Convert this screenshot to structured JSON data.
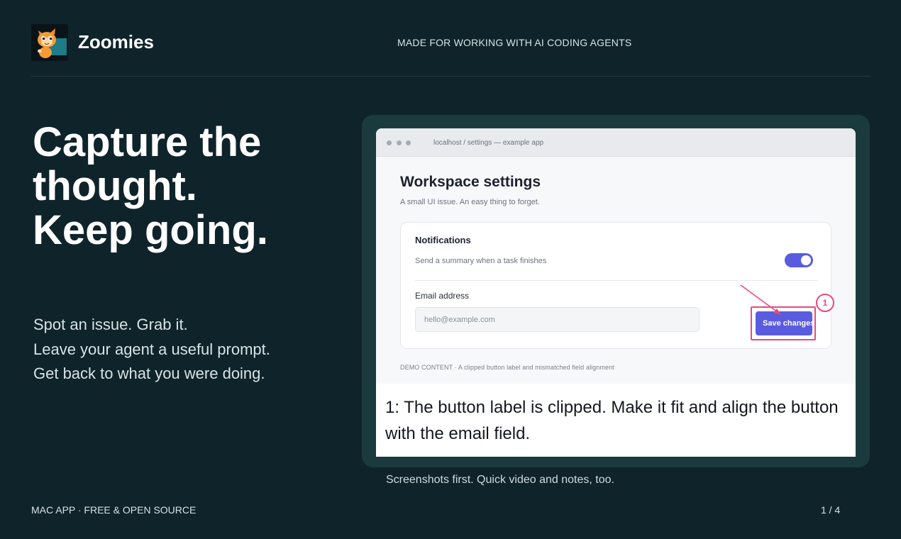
{
  "brand": {
    "name": "Zoomies",
    "logo_icon": "cat-logo-icon"
  },
  "header": {
    "tagline": "MADE FOR WORKING WITH AI CODING AGENTS"
  },
  "hero": {
    "title_lines": [
      "Capture the",
      "thought.",
      "Keep going."
    ],
    "body_lines": [
      "Spot an issue. Grab it.",
      "Leave your agent a useful prompt.",
      "Get back to what you were doing."
    ]
  },
  "showcase": {
    "window": {
      "url": "localhost / settings — example app",
      "title": "Workspace settings",
      "subtitle": "A small UI issue. An easy thing to forget.",
      "notifications": {
        "title": "Notifications",
        "description": "Send a summary when a task finishes",
        "toggle_on": true
      },
      "email": {
        "label": "Email address",
        "placeholder": "hello@example.com",
        "value": ""
      },
      "save_button_label": "Save changes",
      "annotation_number": "1",
      "demo_note": "DEMO CONTENT · A clipped button label and mismatched field alignment"
    },
    "caption": "1: The button label is clipped. Make it fit and align the button with the email field.",
    "subcaption": "Screenshots first. Quick video and notes, too."
  },
  "footer": {
    "left": "MAC APP · FREE & OPEN SOURCE",
    "page_indicator": "1 / 4"
  },
  "colors": {
    "background": "#0f232a",
    "showcase_panel": "#1b3a3e",
    "accent": "#5a5ce0",
    "annotation": "#e8497f"
  }
}
